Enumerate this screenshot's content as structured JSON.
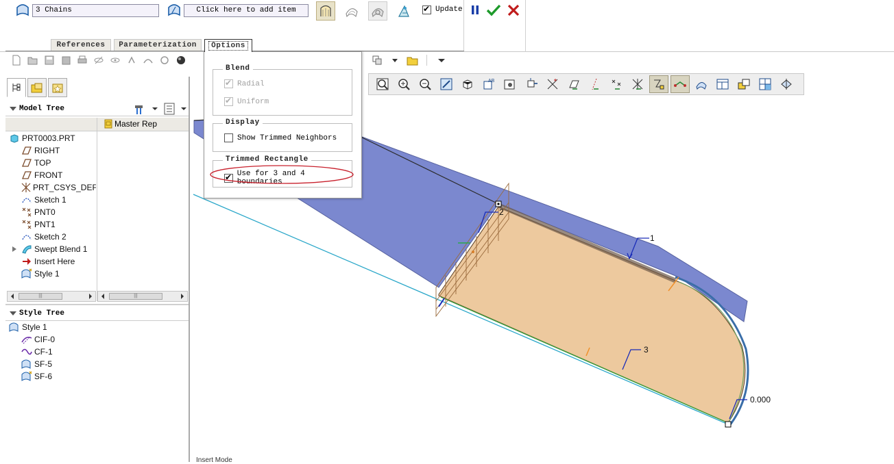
{
  "dashboard": {
    "chains_collector": "3 Chains",
    "add_item_collector": "Click here to add item",
    "update_label": "Update",
    "update_checked": true,
    "tabs": [
      {
        "label": "References",
        "active": false
      },
      {
        "label": "Parameterization",
        "active": false
      },
      {
        "label": "Options",
        "active": true
      }
    ]
  },
  "options_panel": {
    "blend": {
      "title": "Blend",
      "radial_label": "Radial",
      "uniform_label": "Uniform"
    },
    "display": {
      "title": "Display",
      "show_trimmed_label": "Show Trimmed Neighbors"
    },
    "trimmed_rectangle": {
      "title": "Trimmed Rectangle",
      "use_label": "Use for 3 and 4 boundaries"
    }
  },
  "model_tree": {
    "title": "Model Tree",
    "column_header": "Master Rep",
    "items": [
      {
        "label": "PRT0003.PRT",
        "icon": "part-icon",
        "indent": 0
      },
      {
        "label": "RIGHT",
        "icon": "datum-plane-icon",
        "indent": 1
      },
      {
        "label": "TOP",
        "icon": "datum-plane-icon",
        "indent": 1
      },
      {
        "label": "FRONT",
        "icon": "datum-plane-icon",
        "indent": 1
      },
      {
        "label": "PRT_CSYS_DEF",
        "icon": "csys-icon",
        "indent": 1
      },
      {
        "label": "Sketch 1",
        "icon": "sketch-icon",
        "indent": 1
      },
      {
        "label": "PNT0",
        "icon": "datum-point-icon",
        "indent": 1
      },
      {
        "label": "PNT1",
        "icon": "datum-point-icon",
        "indent": 1
      },
      {
        "label": "Sketch 2",
        "icon": "sketch-icon",
        "indent": 1
      },
      {
        "label": "Swept Blend 1",
        "icon": "swept-blend-icon",
        "indent": 1
      },
      {
        "label": "Insert Here",
        "icon": "insert-arrow-icon",
        "indent": 1
      },
      {
        "label": "Style 1",
        "icon": "style-icon",
        "indent": 1
      }
    ]
  },
  "style_tree": {
    "title": "Style Tree",
    "items": [
      {
        "label": "Style 1",
        "icon": "style-icon",
        "indent": 0
      },
      {
        "label": "CIF-0",
        "icon": "curve-icon",
        "indent": 1
      },
      {
        "label": "CF-1",
        "icon": "free-curve-icon",
        "indent": 1
      },
      {
        "label": "SF-5",
        "icon": "surface-icon",
        "indent": 1
      },
      {
        "label": "SF-6",
        "icon": "surface-active-icon",
        "indent": 1
      }
    ]
  },
  "viewport": {
    "labels": [
      "1",
      "2",
      "3",
      "0.000"
    ],
    "status_text": "Insert Mode"
  },
  "colors": {
    "surface_fill": "#edc99e",
    "blue_surface": "#7b88cf",
    "cyan_edge": "#2aa7c9",
    "label_blue": "#1a2cb8"
  }
}
